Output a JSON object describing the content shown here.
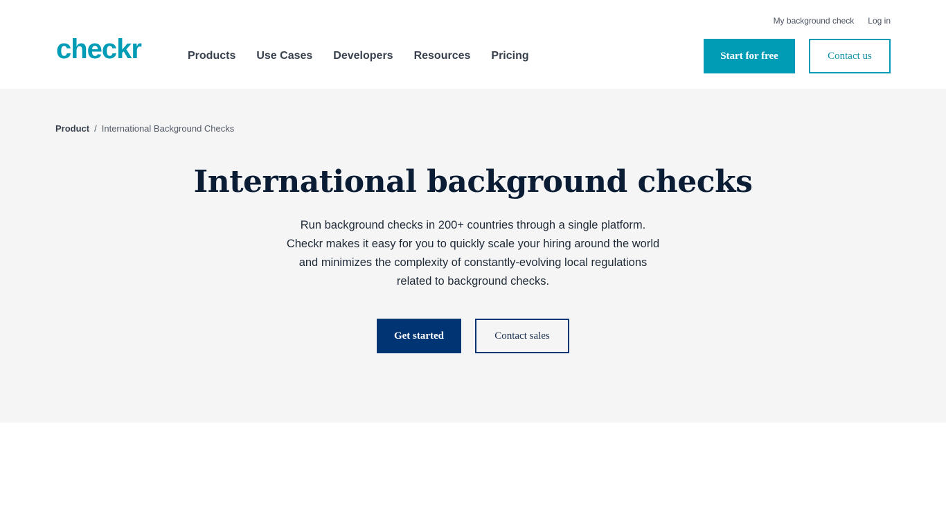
{
  "header": {
    "logo_text": "checkr",
    "nav": [
      {
        "label": "Products"
      },
      {
        "label": "Use Cases"
      },
      {
        "label": "Developers"
      },
      {
        "label": "Resources"
      },
      {
        "label": "Pricing"
      }
    ],
    "utility_links": {
      "my_background_check": "My background check",
      "log_in": "Log in"
    },
    "start_for_free_label": "Start for free",
    "contact_us_label": "Contact us"
  },
  "breadcrumb": {
    "root": "Product",
    "separator": "/",
    "current": "International Background Checks"
  },
  "hero": {
    "title": "International background checks",
    "description_lines": [
      "Run background checks in 200+ countries through a single platform.",
      "Checkr makes it easy for you to quickly scale your hiring around the world",
      "and minimizes the complexity of constantly-evolving local regulations",
      "related to background checks."
    ],
    "get_started_label": "Get started",
    "contact_sales_label": "Contact sales"
  },
  "colors": {
    "brand_teal": "#009bb4",
    "navy": "#003473",
    "hero_bg": "#f5f5f5",
    "title_text": "#0b1c35"
  }
}
